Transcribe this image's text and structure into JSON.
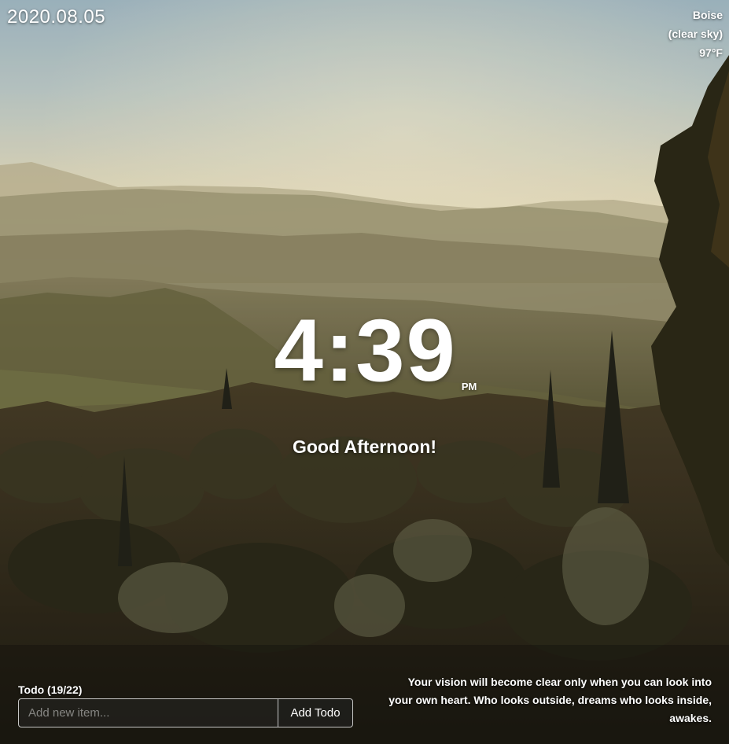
{
  "date": "2020.08.05",
  "weather": {
    "city": "Boise",
    "condition": "(clear sky)",
    "temperature": "97°F"
  },
  "clock": {
    "time": "4:39",
    "period": "PM"
  },
  "greeting": "Good Afternoon!",
  "todo": {
    "header": "Todo (19/22)",
    "input_placeholder": "Add new item...",
    "input_value": "",
    "add_button_label": "Add Todo"
  },
  "quote": "Your vision will become clear only when you can look into your own heart. Who looks outside, dreams who looks inside, awakes.",
  "colors": {
    "text": "#ffffff",
    "sky_top": "#a9c0c9",
    "sky_horizon": "#f3e7bf",
    "foreground": "#2f2b1d"
  }
}
